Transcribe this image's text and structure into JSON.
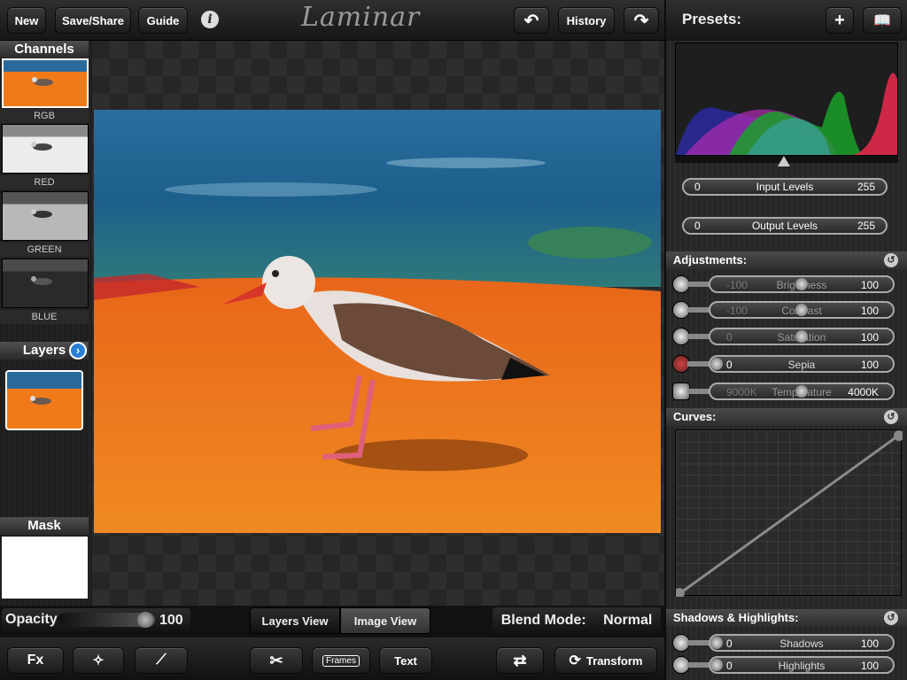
{
  "toolbar": {
    "new_label": "New",
    "save_share_label": "Save/Share",
    "guide_label": "Guide",
    "history_label": "History",
    "logo_text": "Laminar"
  },
  "channels": {
    "title": "Channels",
    "items": [
      {
        "label": "RGB"
      },
      {
        "label": "RED"
      },
      {
        "label": "GREEN"
      },
      {
        "label": "BLUE"
      }
    ]
  },
  "layers": {
    "title": "Layers"
  },
  "mask": {
    "title": "Mask"
  },
  "opacity": {
    "label": "Opacity",
    "value": "100"
  },
  "view_toggle": {
    "layers_view": "Layers View",
    "image_view": "Image View",
    "selected": "Image View"
  },
  "blend": {
    "label": "Blend Mode:",
    "value": "Normal"
  },
  "bottom_tools": {
    "fx_label": "Fx",
    "frames_label": "Frames",
    "text_label": "Text",
    "transform_label": "Transform"
  },
  "presets": {
    "title": "Presets:"
  },
  "levels": {
    "input": {
      "label": "Input Levels",
      "min": "0",
      "max": "255"
    },
    "output": {
      "label": "Output Levels",
      "min": "0",
      "max": "255"
    }
  },
  "adjustments": {
    "title": "Adjustments:",
    "items": [
      {
        "name": "Brightness",
        "min": "-100",
        "max": "100",
        "level": 0.5
      },
      {
        "name": "Contrast",
        "min": "-100",
        "max": "100",
        "level": 0.5
      },
      {
        "name": "Saturation",
        "min": "0",
        "max": "100",
        "level": 0.5
      },
      {
        "name": "Sepia",
        "min": "0",
        "max": "100",
        "level": 0.0
      },
      {
        "name": "Temperature",
        "min": "9000K",
        "max": "4000K",
        "level": 0.5
      }
    ]
  },
  "curves": {
    "title": "Curves:"
  },
  "shadows_highlights": {
    "title": "Shadows & Highlights:",
    "items": [
      {
        "name": "Shadows",
        "min": "0",
        "max": "100",
        "level": 0.0
      },
      {
        "name": "Highlights",
        "min": "0",
        "max": "100",
        "level": 0.0
      }
    ]
  },
  "colors": {
    "accent_blue": "#2a7fd4",
    "sand_orange": "#f07a1a",
    "water_blue": "#1d5f8c"
  }
}
